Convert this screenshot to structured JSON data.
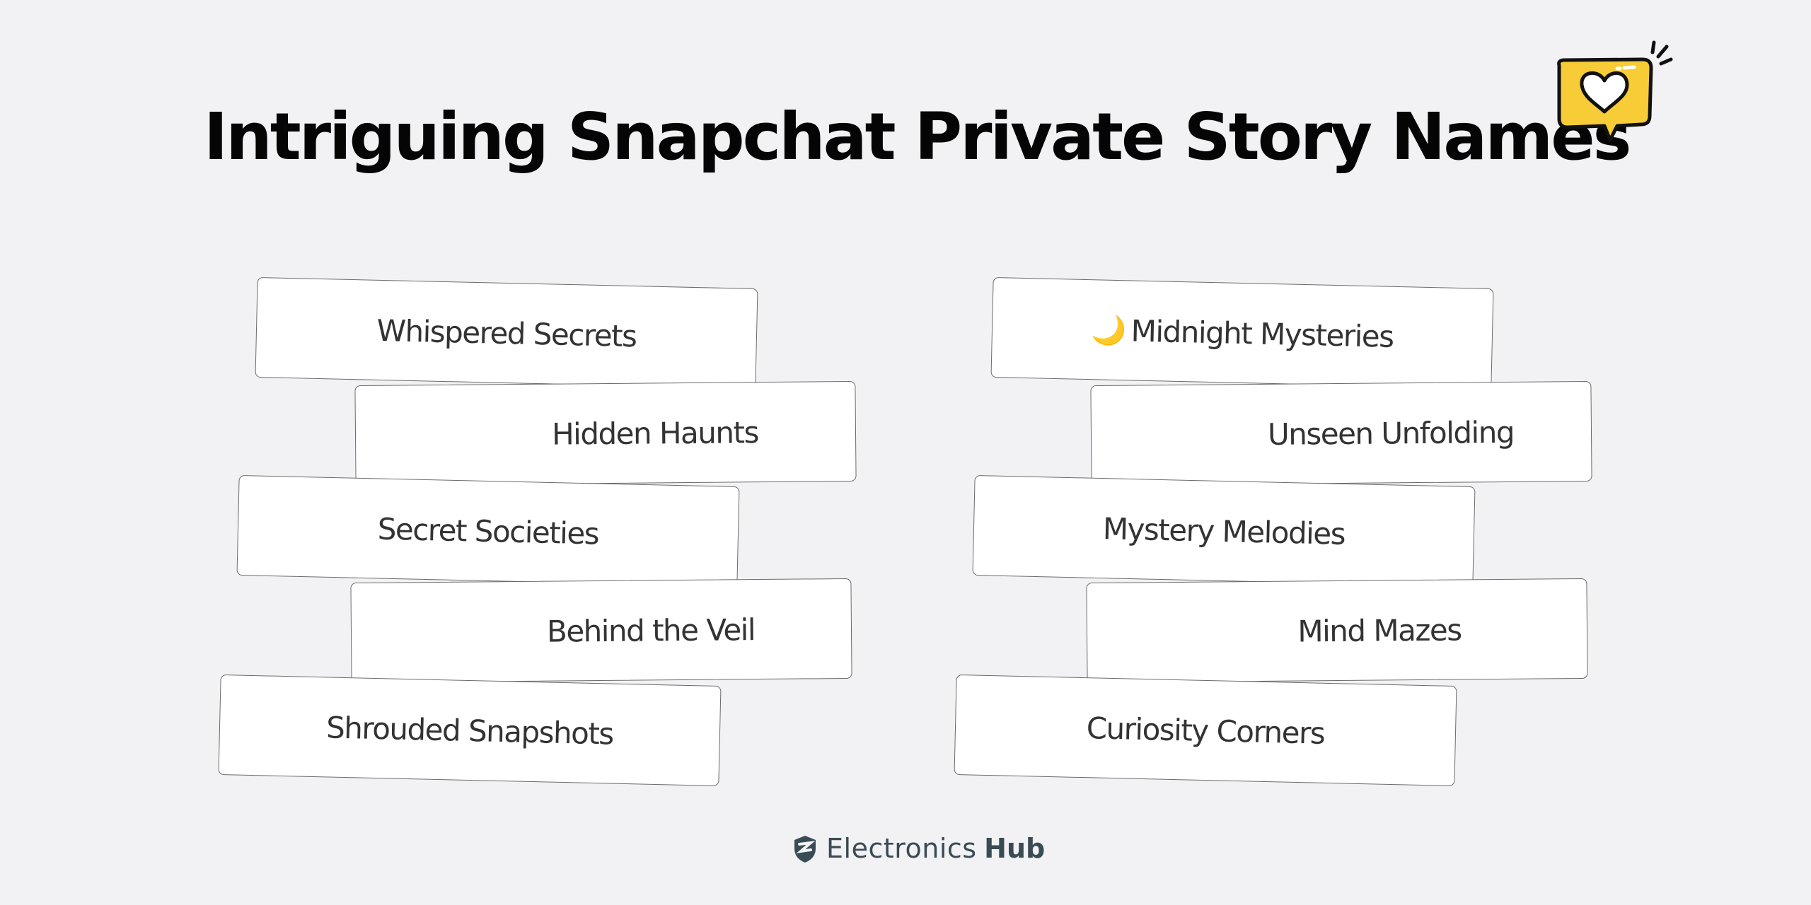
{
  "title": "Intriguing Snapchat Private Story Names",
  "icons": {
    "top_right": "heart-speech-bubble-icon",
    "moon": "crescent-moon-icon",
    "footer_logo": "shield-logo-icon"
  },
  "colors": {
    "background": "#f2f2f4",
    "bubble_yellow": "#f7cc36",
    "card_text": "#333333",
    "moon": "#f4c55a",
    "footer": "#394b55"
  },
  "left_column": [
    {
      "label": "Whispered Secrets"
    },
    {
      "label": "Hidden Haunts"
    },
    {
      "label": "Secret Societies"
    },
    {
      "label": "Behind the Veil"
    },
    {
      "label": "Shrouded Snapshots"
    }
  ],
  "right_column": [
    {
      "label": "Midnight Mysteries",
      "emoji": "🌙"
    },
    {
      "label": "Unseen Unfolding"
    },
    {
      "label": "Mystery Melodies"
    },
    {
      "label": "Mind Mazes"
    },
    {
      "label": "Curiosity Corners"
    }
  ],
  "footer": {
    "brand_light": "Electronics",
    "brand_bold": "Hub"
  }
}
